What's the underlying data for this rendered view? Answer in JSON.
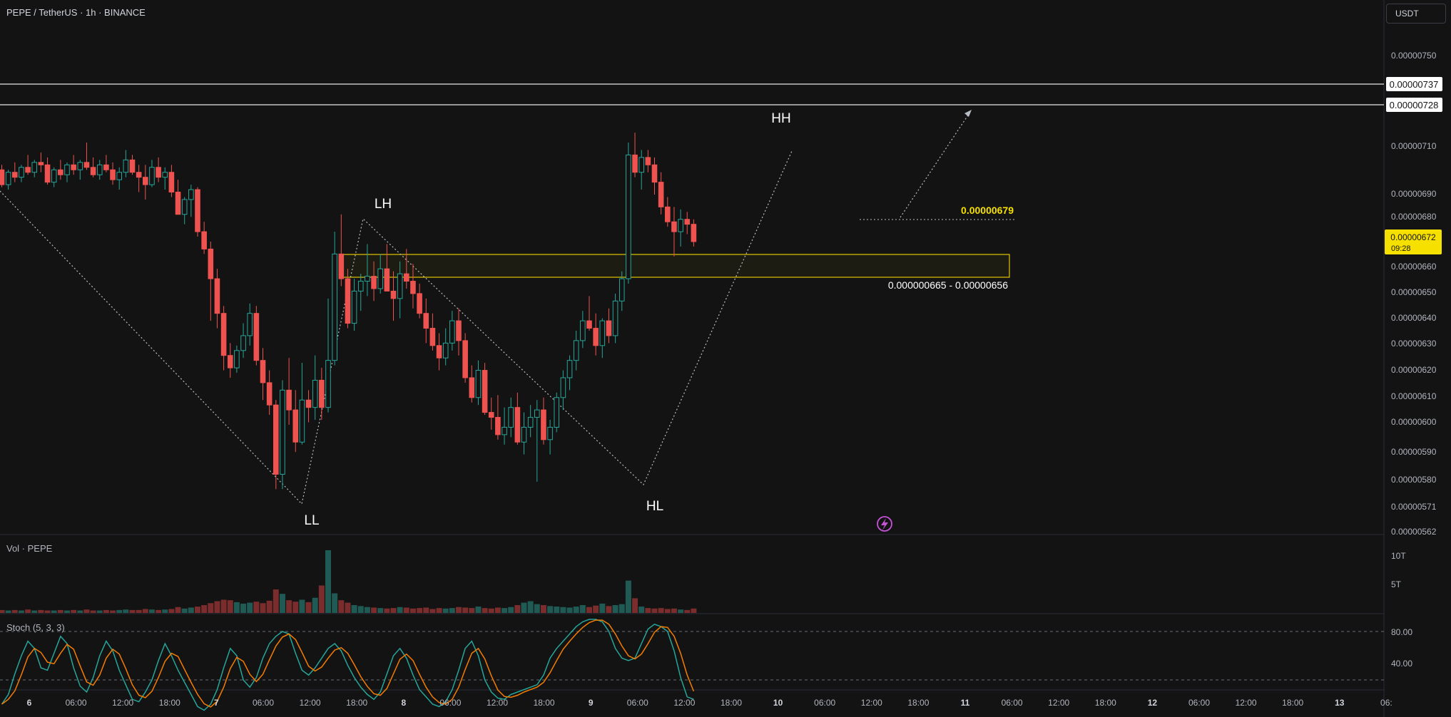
{
  "header": {
    "symbol_title": "PEPE / TetherUS · 1h · BINANCE",
    "currency_button": "USDT"
  },
  "price_axis": {
    "ticks": [
      "0.00000750",
      "0.00000710",
      "0.00000690",
      "0.00000680",
      "0.00000660",
      "0.00000650",
      "0.00000640",
      "0.00000630",
      "0.00000620",
      "0.00000610",
      "0.00000600",
      "0.00000590",
      "0.00000580",
      "0.00000571",
      "0.00000562"
    ],
    "level_tags": [
      "0.00000737",
      "0.00000728"
    ],
    "last_price": "0.00000672",
    "countdown": "09:28"
  },
  "time_axis": {
    "labels": [
      "6",
      "06:00",
      "12:00",
      "18:00",
      "7",
      "06:00",
      "12:00",
      "18:00",
      "8",
      "06:00",
      "12:00",
      "18:00",
      "9",
      "06:00",
      "12:00",
      "18:00",
      "10",
      "06:00",
      "12:00",
      "18:00",
      "11",
      "06:00",
      "12:00",
      "18:00",
      "12",
      "06:00",
      "12:00",
      "18:00",
      "13",
      "06:"
    ]
  },
  "annotations": {
    "swing_labels": [
      "LL",
      "LH",
      "HL",
      "HH"
    ],
    "target_price": "0.00000679",
    "zone_label": "0.000000665 - 0.00000656"
  },
  "volume_pane": {
    "title": "Vol · PEPE",
    "ticks": [
      "10T",
      "5T"
    ]
  },
  "stoch_pane": {
    "title": "Stoch (5, 3, 3)",
    "ticks": [
      "80.00",
      "40.00"
    ]
  },
  "colors": {
    "background": "#131313",
    "up": "#26a69a",
    "down": "#ef5350",
    "zone": "#e0c600",
    "last_price_tag": "#f5e000",
    "stoch_k": "#26a69a",
    "stoch_d": "#f57c00"
  },
  "chart_data": {
    "type": "candlestick",
    "title": "PEPE / TetherUS · 1h · BINANCE",
    "y_range": [
      5.6e-06,
      7.6e-06
    ],
    "candles_ohlc_e8": [
      [
        701,
        703,
        694,
        695
      ],
      [
        695,
        701,
        693,
        700
      ],
      [
        700,
        704,
        696,
        698
      ],
      [
        698,
        703,
        696,
        702
      ],
      [
        702,
        707,
        699,
        700
      ],
      [
        700,
        705,
        698,
        704
      ],
      [
        704,
        708,
        700,
        703
      ],
      [
        703,
        706,
        695,
        696
      ],
      [
        696,
        702,
        694,
        701
      ],
      [
        701,
        705,
        697,
        699
      ],
      [
        699,
        704,
        696,
        703
      ],
      [
        703,
        707,
        699,
        701
      ],
      [
        701,
        705,
        697,
        704
      ],
      [
        704,
        712,
        701,
        702
      ],
      [
        702,
        706,
        698,
        699
      ],
      [
        699,
        705,
        697,
        703
      ],
      [
        703,
        707,
        700,
        701
      ],
      [
        701,
        704,
        695,
        697
      ],
      [
        697,
        702,
        693,
        700
      ],
      [
        700,
        709,
        698,
        705
      ],
      [
        705,
        707,
        699,
        700
      ],
      [
        700,
        703,
        692,
        698
      ],
      [
        698,
        703,
        689,
        695
      ],
      [
        695,
        705,
        694,
        702
      ],
      [
        702,
        706,
        696,
        698
      ],
      [
        698,
        702,
        693,
        700
      ],
      [
        700,
        703,
        690,
        692
      ],
      [
        692,
        697,
        683,
        683
      ],
      [
        683,
        690,
        679,
        689
      ],
      [
        689,
        695,
        682,
        693
      ],
      [
        693,
        694,
        674,
        676
      ],
      [
        676,
        680,
        667,
        669
      ],
      [
        669,
        672,
        640,
        657
      ],
      [
        657,
        661,
        637,
        643
      ],
      [
        643,
        646,
        620,
        626
      ],
      [
        626,
        631,
        617,
        621
      ],
      [
        621,
        630,
        619,
        628
      ],
      [
        628,
        639,
        625,
        634
      ],
      [
        634,
        647,
        630,
        643
      ],
      [
        643,
        646,
        622,
        624
      ],
      [
        624,
        629,
        608,
        615
      ],
      [
        615,
        620,
        602,
        606
      ],
      [
        606,
        608,
        572,
        578
      ],
      [
        578,
        616,
        572,
        612
      ],
      [
        612,
        625,
        598,
        604
      ],
      [
        604,
        612,
        587,
        591
      ],
      [
        591,
        623,
        590,
        608
      ],
      [
        608,
        612,
        599,
        605
      ],
      [
        605,
        626,
        600,
        616
      ],
      [
        616,
        621,
        600,
        605
      ],
      [
        605,
        649,
        603,
        624
      ],
      [
        624,
        676,
        622,
        667
      ],
      [
        667,
        683,
        654,
        657
      ],
      [
        657,
        661,
        637,
        639
      ],
      [
        639,
        657,
        636,
        652
      ],
      [
        652,
        659,
        644,
        656
      ],
      [
        656,
        671,
        650,
        658
      ],
      [
        658,
        664,
        648,
        653
      ],
      [
        653,
        667,
        651,
        661
      ],
      [
        661,
        671,
        656,
        652
      ],
      [
        652,
        660,
        640,
        649
      ],
      [
        649,
        664,
        641,
        659
      ],
      [
        659,
        669,
        653,
        656
      ],
      [
        656,
        663,
        645,
        651
      ],
      [
        651,
        655,
        641,
        643
      ],
      [
        643,
        649,
        631,
        637
      ],
      [
        637,
        643,
        628,
        630
      ],
      [
        630,
        635,
        620,
        625
      ],
      [
        625,
        637,
        622,
        631
      ],
      [
        631,
        644,
        628,
        640
      ],
      [
        640,
        645,
        626,
        632
      ],
      [
        632,
        635,
        615,
        617
      ],
      [
        617,
        622,
        607,
        609
      ],
      [
        609,
        624,
        606,
        620
      ],
      [
        620,
        623,
        602,
        603
      ],
      [
        603,
        609,
        596,
        601
      ],
      [
        601,
        610,
        592,
        594
      ],
      [
        594,
        605,
        590,
        597
      ],
      [
        597,
        609,
        593,
        605
      ],
      [
        605,
        611,
        590,
        591
      ],
      [
        591,
        603,
        586,
        597
      ],
      [
        597,
        606,
        593,
        601
      ],
      [
        601,
        608,
        575,
        604
      ],
      [
        604,
        609,
        590,
        592
      ],
      [
        592,
        600,
        586,
        597
      ],
      [
        597,
        611,
        595,
        609
      ],
      [
        609,
        620,
        604,
        617
      ],
      [
        617,
        626,
        612,
        624
      ],
      [
        624,
        636,
        620,
        632
      ],
      [
        632,
        644,
        629,
        640
      ],
      [
        640,
        650,
        636,
        637
      ],
      [
        637,
        643,
        626,
        630
      ],
      [
        630,
        641,
        625,
        640
      ],
      [
        640,
        645,
        631,
        634
      ],
      [
        634,
        651,
        631,
        648
      ],
      [
        648,
        660,
        644,
        657
      ],
      [
        657,
        712,
        655,
        707
      ],
      [
        707,
        716,
        698,
        700
      ],
      [
        700,
        709,
        693,
        706
      ],
      [
        706,
        709,
        700,
        703
      ],
      [
        703,
        706,
        691,
        696
      ],
      [
        696,
        700,
        683,
        686
      ],
      [
        686,
        690,
        678,
        680
      ],
      [
        680,
        686,
        666,
        676
      ],
      [
        676,
        685,
        670,
        681
      ],
      [
        681,
        684,
        675,
        679
      ],
      [
        679,
        681,
        670,
        672
      ]
    ],
    "volume_T": [
      0.6,
      0.5,
      0.6,
      0.5,
      0.7,
      0.5,
      0.6,
      0.5,
      0.5,
      0.6,
      0.5,
      0.6,
      0.5,
      0.7,
      0.5,
      0.5,
      0.6,
      0.5,
      0.6,
      0.7,
      0.6,
      0.6,
      0.8,
      0.7,
      0.6,
      0.7,
      0.8,
      1.2,
      0.9,
      1.1,
      1.3,
      1.6,
      2.0,
      2.4,
      2.7,
      2.6,
      2.2,
      1.9,
      2.1,
      2.3,
      2.0,
      2.5,
      4.8,
      3.9,
      2.6,
      2.3,
      2.7,
      2.2,
      3.1,
      5.6,
      12.8,
      4.0,
      2.6,
      2.1,
      1.6,
      1.4,
      1.2,
      1.1,
      1.0,
      0.9,
      1.0,
      1.2,
      1.1,
      0.9,
      1.0,
      1.1,
      0.8,
      1.0,
      0.9,
      1.0,
      1.2,
      1.1,
      1.0,
      1.3,
      1.0,
      0.9,
      1.1,
      1.0,
      1.2,
      1.6,
      2.1,
      2.4,
      1.8,
      1.6,
      1.4,
      1.3,
      1.2,
      1.1,
      1.3,
      1.6,
      1.2,
      1.5,
      1.9,
      1.4,
      1.6,
      1.8,
      6.6,
      3.0,
      1.3,
      1.0,
      0.9,
      1.0,
      0.8,
      0.9,
      0.7,
      0.6,
      0.9
    ],
    "stoch_k": [
      20,
      28,
      45,
      60,
      72,
      66,
      50,
      48,
      62,
      76,
      70,
      50,
      35,
      30,
      42,
      60,
      72,
      64,
      48,
      36,
      24,
      22,
      30,
      40,
      56,
      70,
      60,
      48,
      38,
      28,
      18,
      15,
      20,
      32,
      50,
      66,
      60,
      40,
      34,
      42,
      58,
      70,
      76,
      80,
      78,
      62,
      48,
      44,
      50,
      58,
      66,
      70,
      64,
      52,
      42,
      34,
      28,
      24,
      30,
      45,
      60,
      66,
      58,
      44,
      32,
      26,
      20,
      18,
      22,
      32,
      48,
      66,
      72,
      60,
      40,
      30,
      25,
      24,
      28,
      30,
      32,
      34,
      36,
      44,
      58,
      66,
      72,
      78,
      84,
      88,
      90,
      90,
      88,
      80,
      66,
      58,
      56,
      58,
      70,
      82,
      86,
      84,
      80,
      64,
      42,
      26,
      24
    ]
  }
}
